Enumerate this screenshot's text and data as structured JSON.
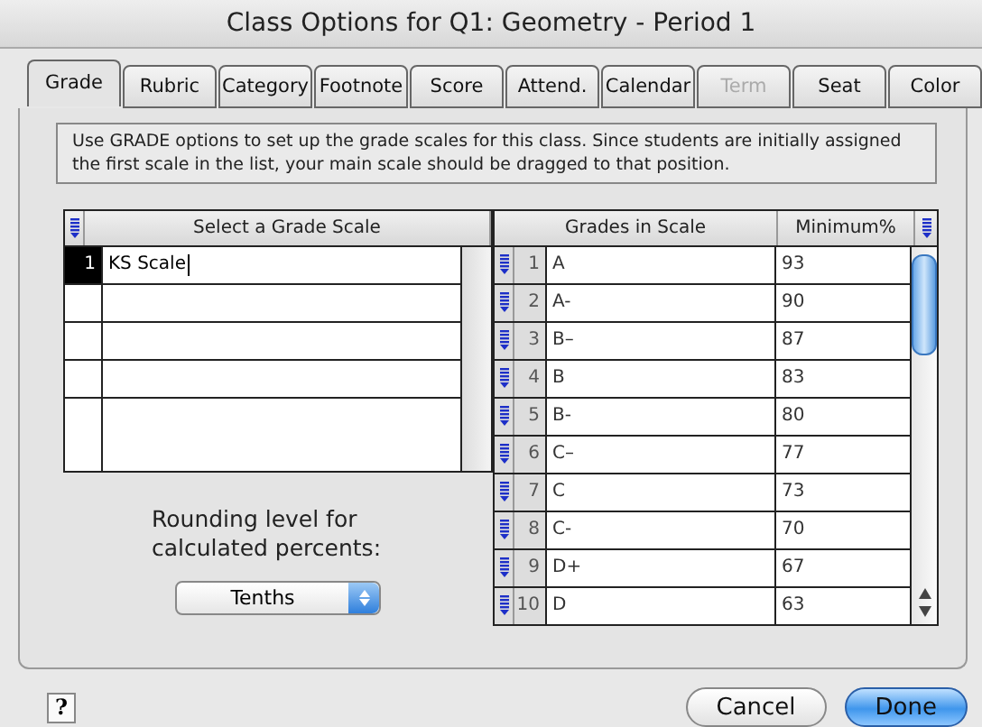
{
  "window": {
    "title": "Class Options for Q1: Geometry - Period 1"
  },
  "tabs": [
    {
      "label": "Grade",
      "selected": true,
      "disabled": false
    },
    {
      "label": "Rubric",
      "selected": false,
      "disabled": false
    },
    {
      "label": "Category",
      "selected": false,
      "disabled": false
    },
    {
      "label": "Footnote",
      "selected": false,
      "disabled": false
    },
    {
      "label": "Score",
      "selected": false,
      "disabled": false
    },
    {
      "label": "Attend.",
      "selected": false,
      "disabled": false
    },
    {
      "label": "Calendar",
      "selected": false,
      "disabled": false
    },
    {
      "label": "Term",
      "selected": false,
      "disabled": true
    },
    {
      "label": "Seat",
      "selected": false,
      "disabled": false
    },
    {
      "label": "Color",
      "selected": false,
      "disabled": false
    }
  ],
  "info": "Use GRADE options to set up the grade scales for this class. Since students are initially assigned the first scale in the list, your main scale should be dragged to that position.",
  "scales": {
    "header": "Select a Grade Scale",
    "rows": [
      {
        "number": "1",
        "name": "KS Scale",
        "selected": true
      }
    ]
  },
  "grades": {
    "columns": [
      "Grades in Scale",
      "Minimum%"
    ],
    "rows": [
      {
        "number": "1",
        "grade": "A",
        "minimum": "93"
      },
      {
        "number": "2",
        "grade": "A-",
        "minimum": "90"
      },
      {
        "number": "3",
        "grade": "B–",
        "minimum": "87"
      },
      {
        "number": "4",
        "grade": "B",
        "minimum": "83"
      },
      {
        "number": "5",
        "grade": "B-",
        "minimum": "80"
      },
      {
        "number": "6",
        "grade": "C–",
        "minimum": "77"
      },
      {
        "number": "7",
        "grade": "C",
        "minimum": "73"
      },
      {
        "number": "8",
        "grade": "C-",
        "minimum": "70"
      },
      {
        "number": "9",
        "grade": "D+",
        "minimum": "67"
      },
      {
        "number": "10",
        "grade": "D",
        "minimum": "63"
      }
    ]
  },
  "rounding": {
    "label": "Rounding level for calculated percents:",
    "value": "Tenths"
  },
  "help": "?",
  "buttons": [
    {
      "label": "Cancel",
      "default": false
    },
    {
      "label": "Done",
      "default": true
    }
  ]
}
